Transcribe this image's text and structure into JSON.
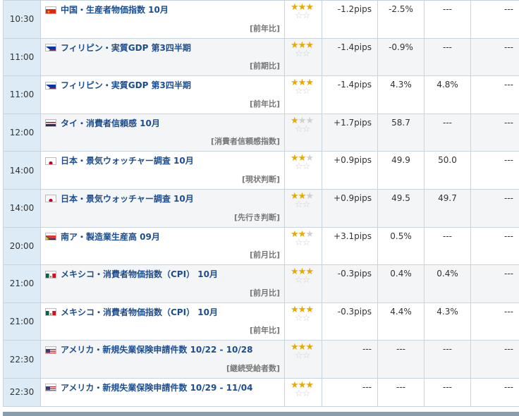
{
  "rows": [
    {
      "time": "10:30",
      "flag": "cn",
      "name": "中国・生産者物価指数 10月",
      "sub": "[前年比]",
      "stars": 3,
      "pips": "-1.2pips",
      "prev": "-2.5%",
      "forecast": "---",
      "actual": "---"
    },
    {
      "time": "11:00",
      "flag": "ph",
      "name": "フィリピン・実質GDP 第3四半期",
      "sub": "[前期比]",
      "stars": 3,
      "pips": "-1.4pips",
      "prev": "-0.9%",
      "forecast": "---",
      "actual": "---"
    },
    {
      "time": "11:00",
      "flag": "ph",
      "name": "フィリピン・実質GDP 第3四半期",
      "sub": "[前年比]",
      "stars": 3,
      "pips": "-1.4pips",
      "prev": "4.3%",
      "forecast": "4.8%",
      "actual": "---"
    },
    {
      "time": "12:00",
      "flag": "th",
      "name": "タイ・消費者信頼感 10月",
      "sub": "[消費者信頼感指数]",
      "stars": 1,
      "pips": "+1.7pips",
      "prev": "58.7",
      "forecast": "---",
      "actual": "---"
    },
    {
      "time": "14:00",
      "flag": "jp",
      "name": "日本・景気ウォッチャー調査 10月",
      "sub": "[現状判断]",
      "stars": 2,
      "pips": "+0.9pips",
      "prev": "49.9",
      "forecast": "50.0",
      "actual": "---"
    },
    {
      "time": "14:00",
      "flag": "jp",
      "name": "日本・景気ウォッチャー調査 10月",
      "sub": "[先行き判断]",
      "stars": 2,
      "pips": "+0.9pips",
      "prev": "49.5",
      "forecast": "49.7",
      "actual": "---"
    },
    {
      "time": "20:00",
      "flag": "za",
      "name": "南ア・製造業生産高 09月",
      "sub": "[前月比]",
      "stars": 2,
      "pips": "+3.1pips",
      "prev": "0.5%",
      "forecast": "---",
      "actual": "---"
    },
    {
      "time": "21:00",
      "flag": "mx",
      "name": "メキシコ・消費者物価指数（CPI） 10月",
      "sub": "[前月比]",
      "stars": 3,
      "pips": "-0.3pips",
      "prev": "0.4%",
      "forecast": "0.4%",
      "actual": "---"
    },
    {
      "time": "21:00",
      "flag": "mx",
      "name": "メキシコ・消費者物価指数（CPI） 10月",
      "sub": "[前年比]",
      "stars": 3,
      "pips": "-0.3pips",
      "prev": "4.4%",
      "forecast": "4.3%",
      "actual": "---"
    },
    {
      "time": "22:30",
      "flag": "us",
      "name": "アメリカ・新規失業保険申請件数 10/22 - 10/28",
      "sub": "[継続受給者数]",
      "stars": 3,
      "pips": "---",
      "prev": "---",
      "forecast": "---",
      "actual": "---"
    },
    {
      "time": "22:30",
      "flag": "us",
      "name": "アメリカ・新規失業保険申請件数 10/29 - 11/04",
      "sub": "",
      "stars": 3,
      "pips": "---",
      "prev": "---",
      "forecast": "---",
      "actual": "---"
    }
  ],
  "colors": {
    "time_bg": "#dcebf5",
    "title": "#1d4d8f",
    "star_on": "#e8a900",
    "star_off": "#d0d0d0"
  }
}
